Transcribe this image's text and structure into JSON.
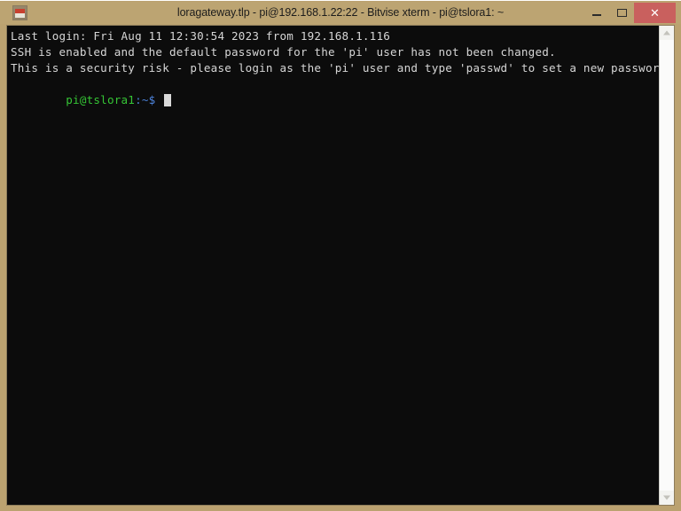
{
  "window": {
    "title": "loragateway.tlp - pi@192.168.1.22:22 - Bitvise xterm - pi@tslora1: ~",
    "icon": "bitvise-app-icon",
    "frame_color": "#bca472",
    "controls": {
      "minimize_label": "–",
      "maximize_label": "□",
      "close_label": "✕",
      "close_color": "#c9605e"
    }
  },
  "terminal": {
    "background": "#0c0c0c",
    "foreground": "#d6d6d6",
    "lines": [
      "Last login: Fri Aug 11 12:30:54 2023 from 192.168.1.116",
      "",
      "SSH is enabled and the default password for the 'pi' user has not been changed.",
      "This is a security risk - please login as the 'pi' user and type 'passwd' to set a new password."
    ],
    "prompt": {
      "user_host": "pi@tslora1",
      "path": ":~",
      "symbol": "$",
      "user_color": "#35c535",
      "path_color": "#4a7fd4",
      "cursor": "block"
    }
  },
  "scrollbar": {
    "up_arrow": "chevron-up-icon",
    "down_arrow": "chevron-down-icon",
    "track_color": "#fbfbfa"
  }
}
